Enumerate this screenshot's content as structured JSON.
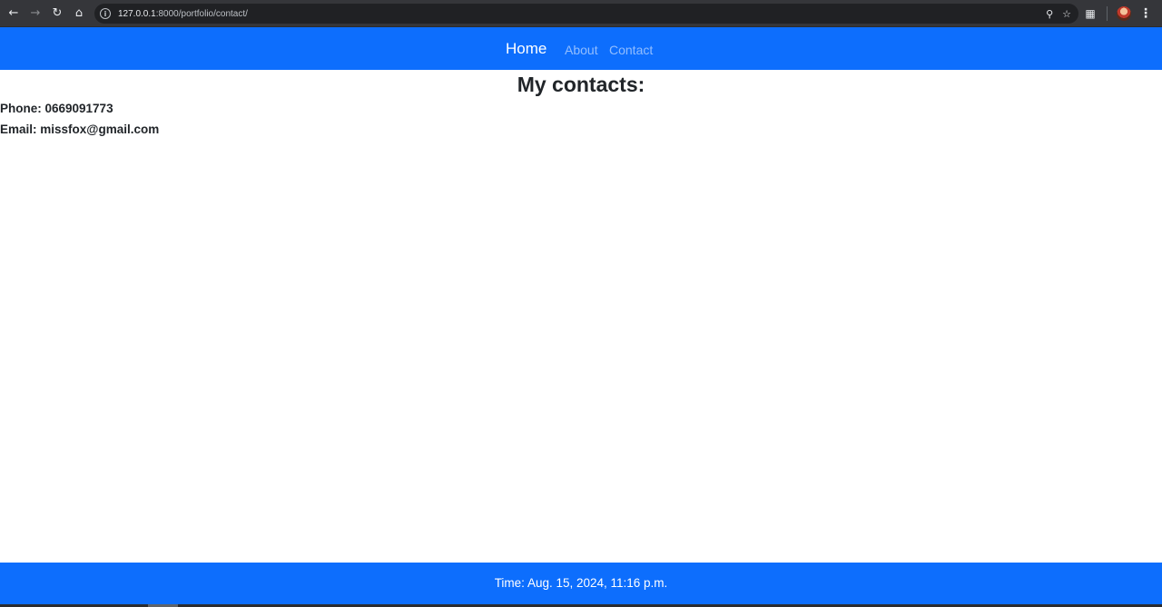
{
  "browser": {
    "url_host": "127.0.0.1",
    "url_rest": ":8000/portfolio/contact/",
    "icons": {
      "back": "arrow-left-icon",
      "forward": "arrow-right-icon",
      "reload": "reload-icon",
      "home": "home-icon",
      "site_info": "info-icon",
      "zoom": "zoom-icon",
      "bookmark": "star-icon",
      "extensions": "puzzle-icon",
      "profile": "avatar",
      "menu": "kebab-menu-icon"
    }
  },
  "navbar": {
    "brand": "Home",
    "links": [
      {
        "label": "About"
      },
      {
        "label": "Contact"
      }
    ],
    "background": "#0d6efd"
  },
  "main": {
    "title": "My contacts:",
    "phone": "Phone: 0669091773",
    "email": "Email: missfox@gmail.com"
  },
  "footer": {
    "time": "Time: Aug. 15, 2024, 11:16 p.m.",
    "background": "#0d6efd"
  }
}
